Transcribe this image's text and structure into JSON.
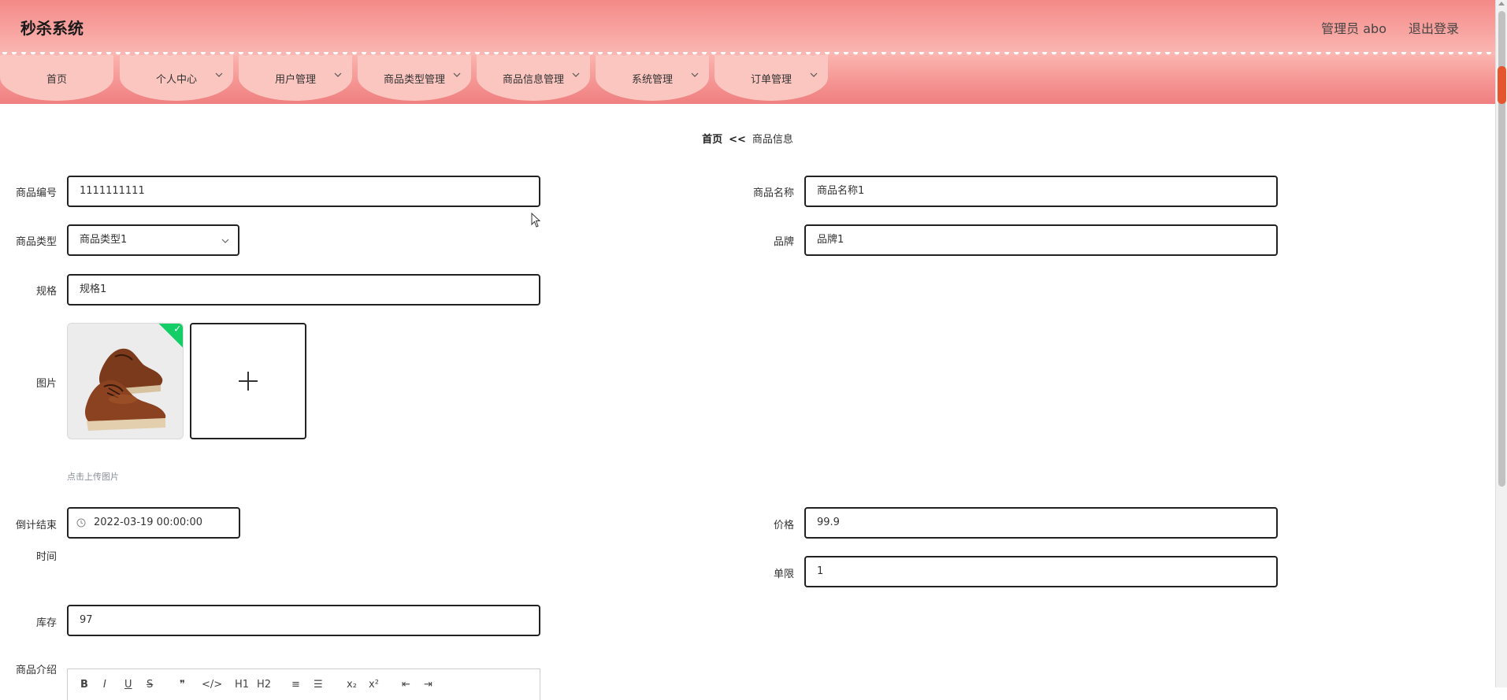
{
  "header": {
    "title": "秒杀系统",
    "user": "管理员 abo",
    "logout": "退出登录"
  },
  "nav": {
    "items": [
      {
        "label": "首页",
        "dropdown": false
      },
      {
        "label": "个人中心",
        "dropdown": true
      },
      {
        "label": "用户管理",
        "dropdown": true
      },
      {
        "label": "商品类型管理",
        "dropdown": true
      },
      {
        "label": "商品信息管理",
        "dropdown": true
      },
      {
        "label": "系统管理",
        "dropdown": true
      },
      {
        "label": "订单管理",
        "dropdown": true
      }
    ]
  },
  "breadcrumb": {
    "home": "首页",
    "separator": "<<",
    "current": "商品信息"
  },
  "form": {
    "code": {
      "label": "商品编号",
      "value": "1111111111"
    },
    "name": {
      "label": "商品名称",
      "value": "商品名称1"
    },
    "type": {
      "label": "商品类型",
      "value": "商品类型1"
    },
    "brand": {
      "label": "品牌",
      "value": "品牌1"
    },
    "spec": {
      "label": "规格",
      "value": "规格1"
    },
    "image": {
      "label": "图片",
      "tip": "点击上传图片"
    },
    "countdown": {
      "label_line1": "倒计结束",
      "label_line2": "时间",
      "value": "2022-03-19 00:00:00"
    },
    "price": {
      "label": "价格",
      "value": "99.9"
    },
    "limit": {
      "label": "单限",
      "value": "1"
    },
    "stock": {
      "label": "库存",
      "value": "97"
    },
    "intro": {
      "label": "商品介绍"
    }
  },
  "editor_toolbar": [
    "B",
    "I",
    "U",
    "S",
    "❞",
    "</>",
    "H1",
    "H2",
    "≡",
    "☰",
    "x₂",
    "x²",
    "⇤",
    "⇥"
  ],
  "colors": {
    "header_top": "#f48a87",
    "nav_item": "#fcc6c0",
    "success": "#13ce66",
    "scroll_marker": "#e4572e"
  }
}
